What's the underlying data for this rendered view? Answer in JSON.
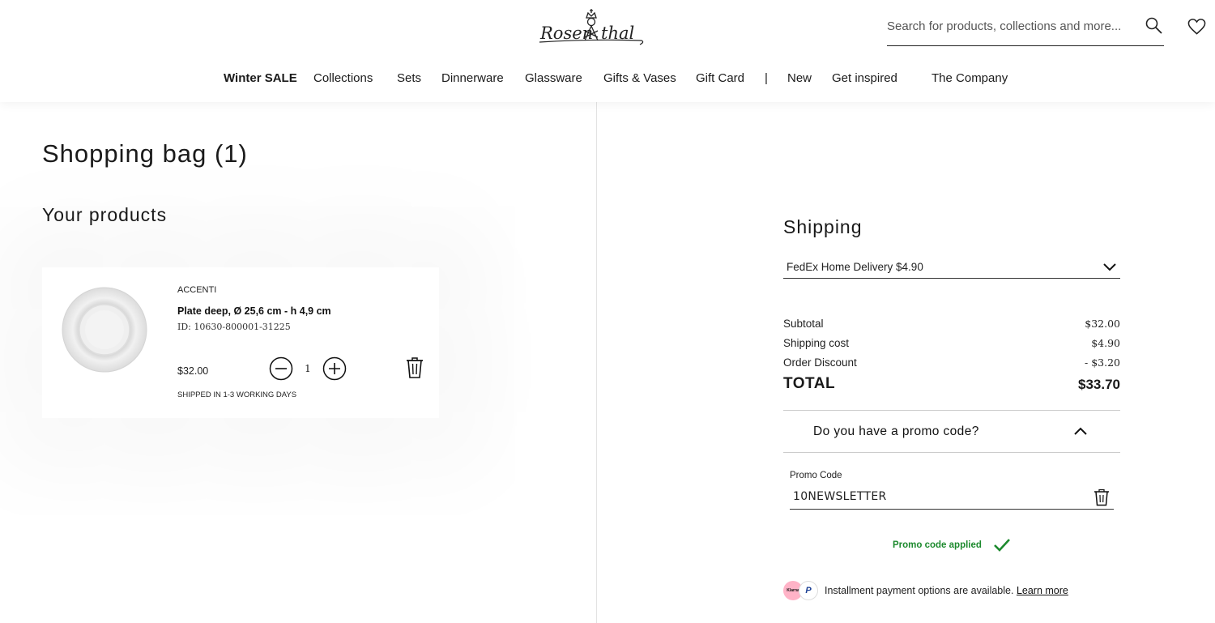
{
  "header": {
    "logo_text": "Rosenthal",
    "search_placeholder": "Search for products, collections and more...",
    "icons": [
      "search-icon",
      "heart-icon"
    ]
  },
  "nav": {
    "items": [
      {
        "label": "Winter SALE"
      },
      {
        "label": "Collections"
      },
      {
        "label": "Sets"
      },
      {
        "label": "Dinnerware"
      },
      {
        "label": "Glassware"
      },
      {
        "label": "Gifts & Vases"
      },
      {
        "label": "Gift Card"
      },
      {
        "label": "|"
      },
      {
        "label": "New"
      },
      {
        "label": "Get inspired"
      },
      {
        "label": "The Company"
      }
    ]
  },
  "bag": {
    "title": "Shopping bag (1)",
    "section_title": "Your products",
    "product": {
      "brand": "ACCENTI",
      "name": "Plate deep, Ø 25,6 cm - h 4,9 cm",
      "id": "ID: 10630-800001-31225",
      "price": "$32.00",
      "quantity": "1",
      "shipping_note": "SHIPPED IN 1-3 WORKING DAYS",
      "icons": [
        "plate-image",
        "minus-circle-icon",
        "plus-circle-icon",
        "trash-icon"
      ]
    }
  },
  "summary": {
    "shipping_title": "Shipping",
    "shipping_option": "FedEx Home Delivery $4.90",
    "subtotal_label": "Subtotal",
    "subtotal_value": "$32.00",
    "shipping_cost_label": "Shipping cost",
    "shipping_cost_value": "$4.90",
    "discount_label": "Order Discount",
    "discount_value": "- $3.20",
    "total_label": "TOTAL",
    "total_value": "$33.70",
    "promo_question": "Do you have a promo code?",
    "promo_field_label": "Promo Code",
    "promo_code_value": "10NEWSLETTER",
    "promo_status": "Promo code applied",
    "payment_text": "Installment payment options are available.",
    "learn_more": "Learn more",
    "klarna_label": "Klarna",
    "paypal_label": "P",
    "status_color": "#1d8a2e"
  }
}
